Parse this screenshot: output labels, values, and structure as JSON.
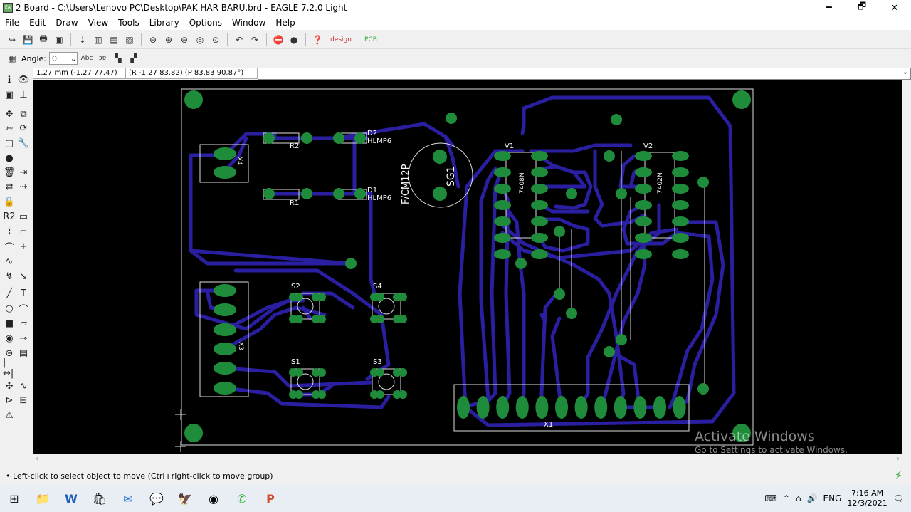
{
  "window": {
    "title": "2 Board - C:\\Users\\Lenovo PC\\Desktop\\PAK HAR BARU.brd - EAGLE 7.2.0 Light",
    "minimize": "🗕",
    "maximize": "🗗",
    "close": "✕"
  },
  "menu": [
    "File",
    "Edit",
    "Draw",
    "View",
    "Tools",
    "Library",
    "Options",
    "Window",
    "Help"
  ],
  "toolbar2": {
    "angle_label": "Angle:",
    "angle_value": "0"
  },
  "coords": {
    "grid": "1.27 mm (-1.27 77.47)",
    "relative": "(R -1.27 83.82) (P 83.83 90.87°)"
  },
  "board": {
    "colors": {
      "trace": "#2a1fa0",
      "pad": "#1e8c3a",
      "silk": "#ffffff",
      "background": "#000000"
    },
    "labels": {
      "r2": "R2",
      "r1": "R1",
      "d2": "D2",
      "d2v": "HLMP6",
      "d1": "D1",
      "d1v": "HLMP6",
      "sg1": "SG1",
      "sg1v": "F/CM12P",
      "v1": "V1",
      "v1v": "7408N",
      "v2": "V2",
      "v2v": "7402N",
      "x4": "X4",
      "x3": "X3",
      "s1": "S1",
      "s2": "S2",
      "s3": "S3",
      "s4": "S4",
      "x1": "X1"
    }
  },
  "status": "• Left-click to select object to move (Ctrl+right-click to move group)",
  "watermark": {
    "line1": "Activate Windows",
    "line2": "Go to Settings to activate Windows."
  },
  "tray": {
    "lang": "ENG",
    "time": "7:16 AM",
    "date": "12/3/2021"
  }
}
